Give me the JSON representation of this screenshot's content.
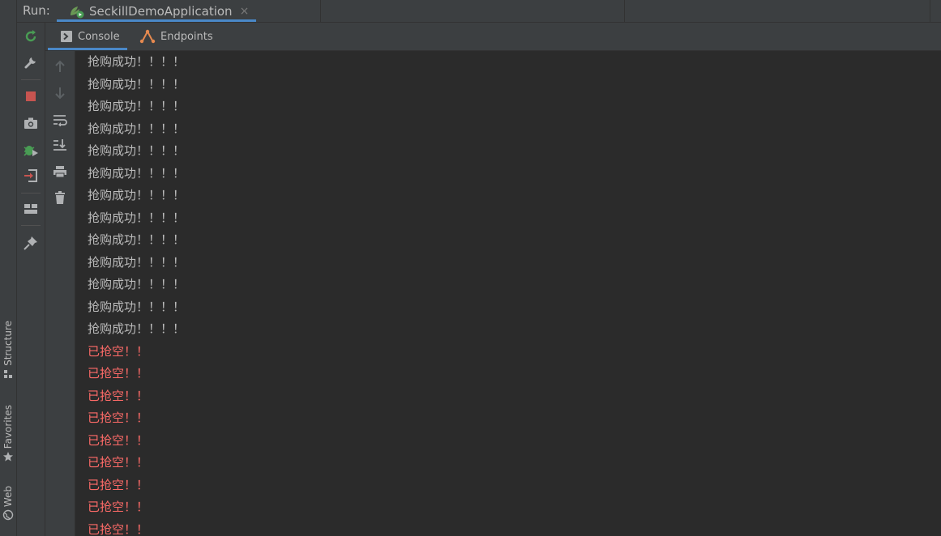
{
  "run_bar": {
    "label": "Run:",
    "tab_title": "SeckillDemoApplication",
    "tab_close": "×"
  },
  "tabs": [
    {
      "label": "Console",
      "active": true
    },
    {
      "label": "Endpoints",
      "active": false
    }
  ],
  "side_tabs": [
    {
      "label": "Structure",
      "icon": "structure-icon"
    },
    {
      "label": "Favorites",
      "icon": "star-icon"
    },
    {
      "label": "Web",
      "icon": "globe-icon"
    }
  ],
  "run_toolbar_icons": [
    "rerun-icon",
    "wrench-icon",
    "stop-icon",
    "camera-icon",
    "debug-bug-icon",
    "exit-icon",
    "layout-icon",
    "pin-icon"
  ],
  "console_toolbar_icons": [
    "up-arrow-icon",
    "down-arrow-icon",
    "soft-wrap-icon",
    "scroll-to-end-icon",
    "print-icon",
    "trash-icon"
  ],
  "colors": {
    "success_text": "#bbbbbb",
    "error_text": "#ff6b68",
    "accent": "#4a88c7",
    "stop": "#c75450",
    "run_green": "#499c54"
  },
  "console": {
    "lines": [
      {
        "text": "抢购成功！！！！",
        "type": "ok"
      },
      {
        "text": "抢购成功！！！！",
        "type": "ok"
      },
      {
        "text": "抢购成功！！！！",
        "type": "ok"
      },
      {
        "text": "抢购成功！！！！",
        "type": "ok"
      },
      {
        "text": "抢购成功！！！！",
        "type": "ok"
      },
      {
        "text": "抢购成功！！！！",
        "type": "ok"
      },
      {
        "text": "抢购成功！！！！",
        "type": "ok"
      },
      {
        "text": "抢购成功！！！！",
        "type": "ok"
      },
      {
        "text": "抢购成功！！！！",
        "type": "ok"
      },
      {
        "text": "抢购成功！！！！",
        "type": "ok"
      },
      {
        "text": "抢购成功！！！！",
        "type": "ok"
      },
      {
        "text": "抢购成功！！！！",
        "type": "ok"
      },
      {
        "text": "抢购成功！！！！",
        "type": "ok"
      },
      {
        "text": "已抢空！！",
        "type": "err"
      },
      {
        "text": "已抢空！！",
        "type": "err"
      },
      {
        "text": "已抢空！！",
        "type": "err"
      },
      {
        "text": "已抢空！！",
        "type": "err"
      },
      {
        "text": "已抢空！！",
        "type": "err"
      },
      {
        "text": "已抢空！！",
        "type": "err"
      },
      {
        "text": "已抢空！！",
        "type": "err"
      },
      {
        "text": "已抢空！！",
        "type": "err"
      },
      {
        "text": "已抢空！！",
        "type": "err"
      }
    ]
  }
}
